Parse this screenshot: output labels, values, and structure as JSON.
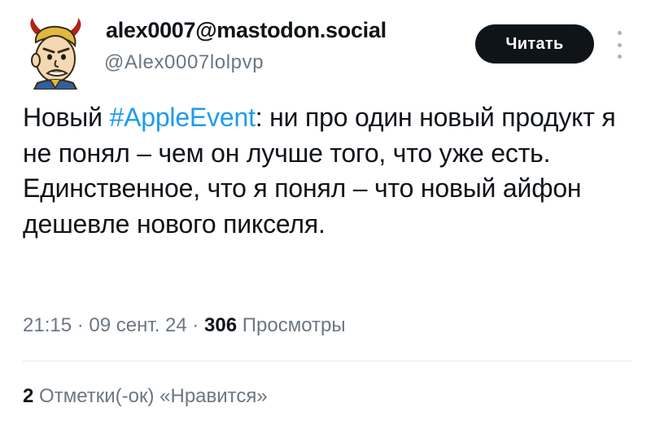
{
  "author": {
    "display_name": "alex0007@mastodon.social",
    "handle": "@Alex0007lolpvp",
    "avatar": "vault-boy-devil-avatar"
  },
  "follow_button": {
    "label": "Читать"
  },
  "menu": {
    "icon": "more-vertical-icon"
  },
  "tweet": {
    "text_before": "Новый ",
    "hashtag": "#AppleEvent",
    "text_after": ": ни про один новый продукт я не понял – чем он лучше того, что уже есть. Единственное, что я понял – что новый айфон дешевле нового пикселя."
  },
  "meta": {
    "time": "21:15",
    "separator": " · ",
    "date": "09 сент. 24",
    "views_count": "306",
    "views_label": "Просмотры"
  },
  "likes": {
    "count": "2",
    "label": "Отметки(-ок) «Нравится»"
  },
  "colors": {
    "link": "#1d9bf0",
    "text": "#0f1419",
    "secondary": "#6b7782",
    "button_bg": "#0f1419"
  }
}
